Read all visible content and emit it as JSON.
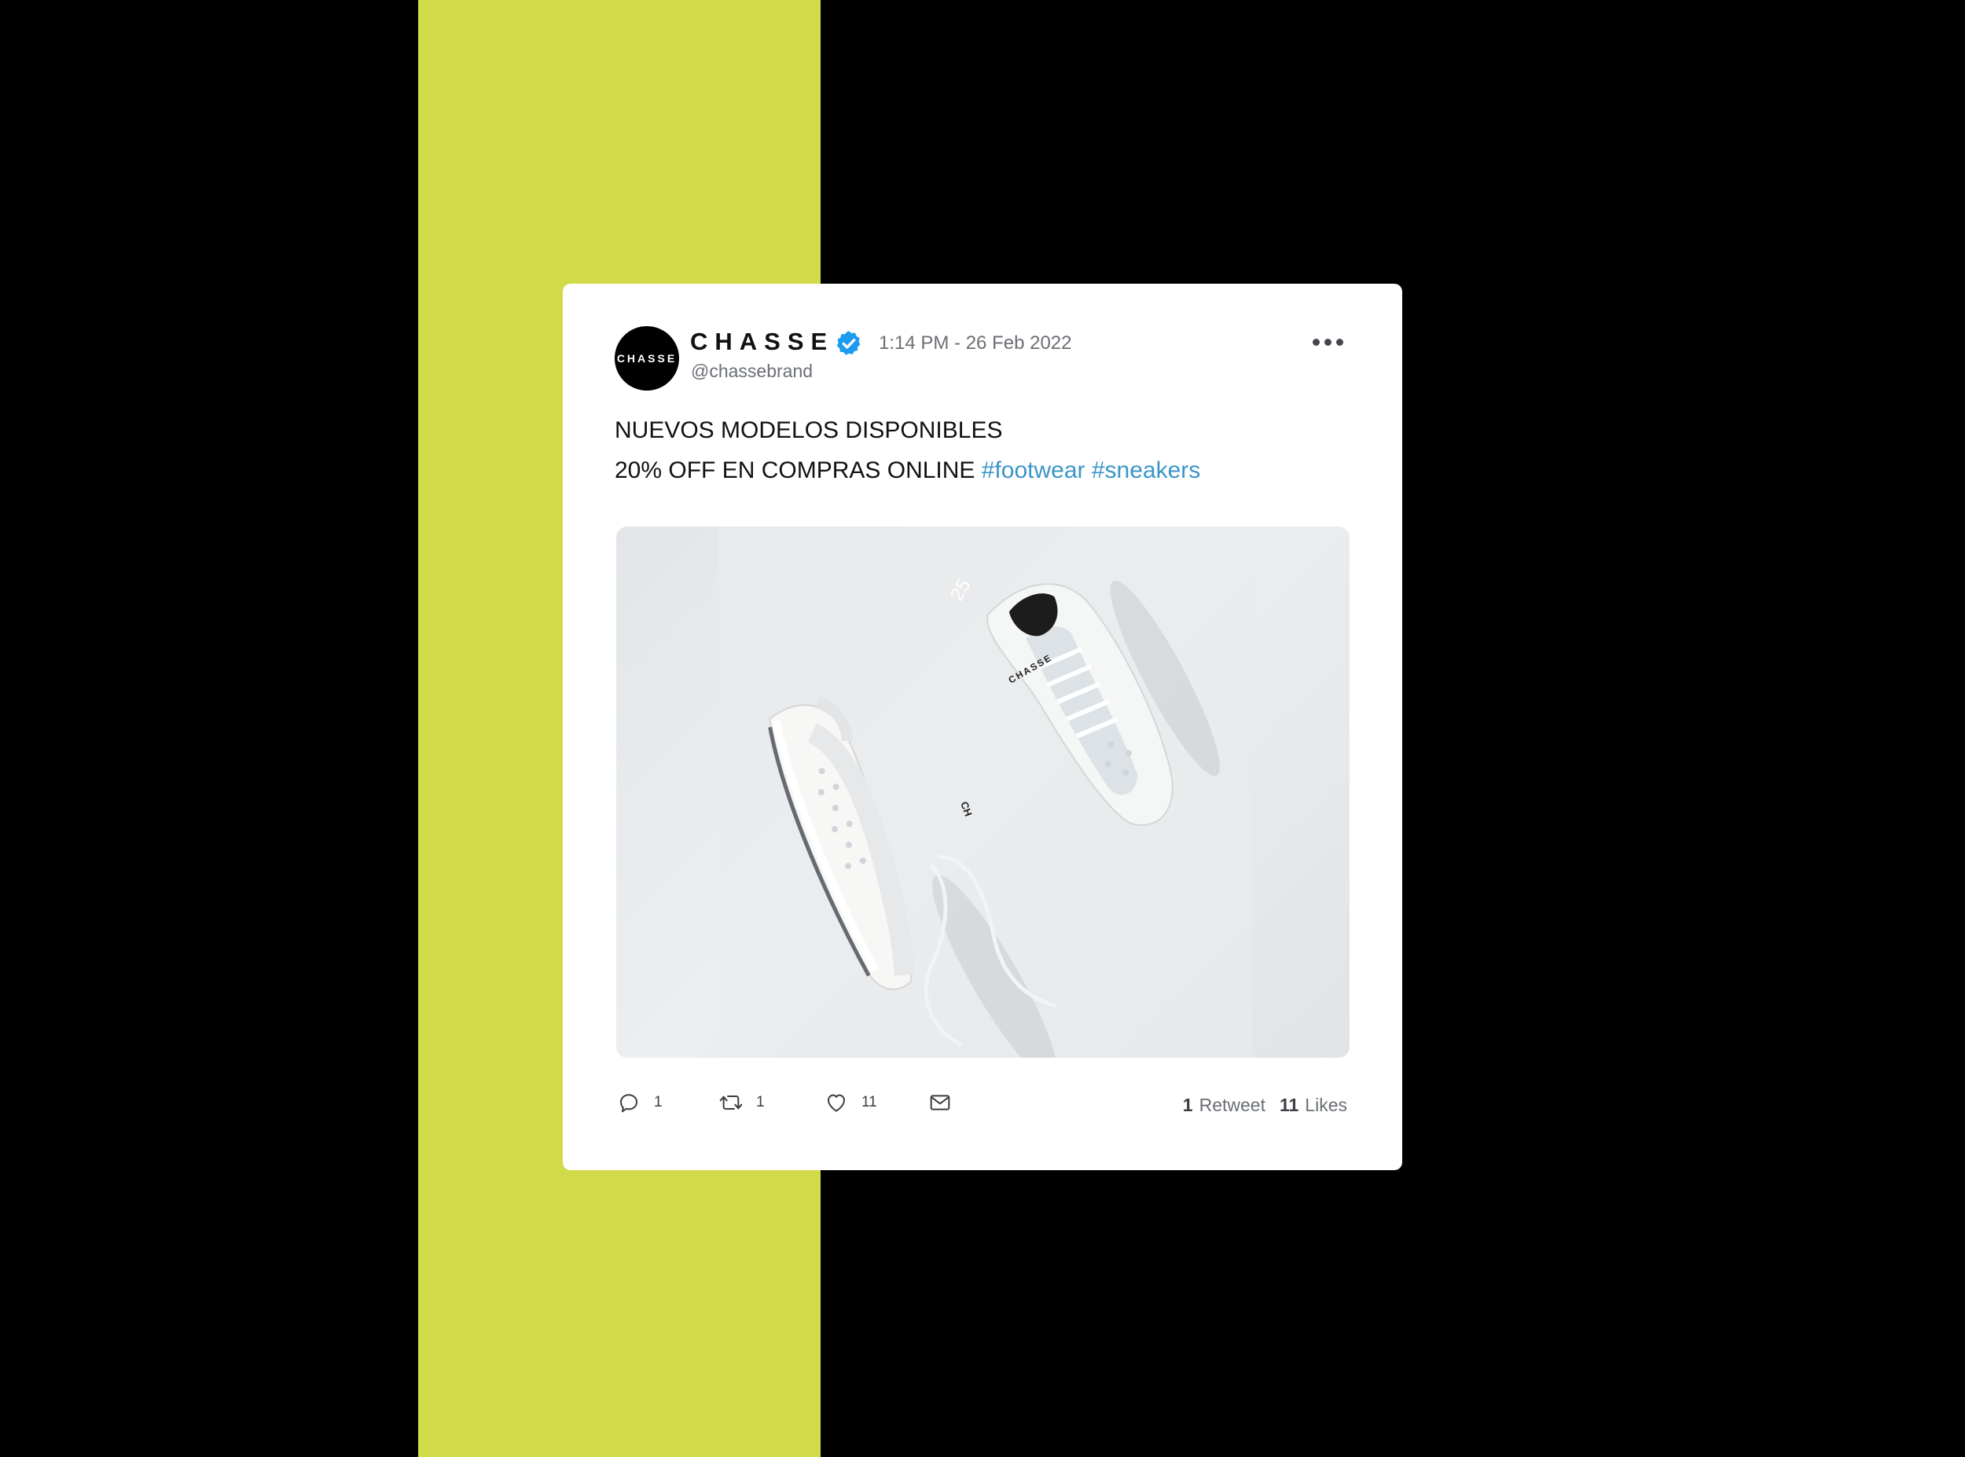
{
  "colors": {
    "background": "#000000",
    "accent_stripe": "#d1db4a",
    "card": "#ffffff",
    "hashtag": "#3a96c8",
    "verified_badge": "#1d9bf0",
    "muted_text": "#6b6f74"
  },
  "tweet": {
    "avatar_text": "CHASSE",
    "display_name": "CHASSE",
    "verified_icon": "verified-badge-icon",
    "timestamp": "1:14 PM - 26 Feb 2022",
    "handle": "@chassebrand",
    "more_icon": "more-dots-icon",
    "text_line1": "NUEVOS MODELOS DISPONIBLES",
    "text_line2": "20% OFF EN COMPRAS ONLINE",
    "hashtags": [
      "#footwear",
      "#sneakers"
    ],
    "photo": {
      "shoe_tongue_number": "25",
      "shoe_brand": "CHASSE"
    },
    "actions": {
      "reply": {
        "icon": "reply-icon",
        "count": "1"
      },
      "retweet": {
        "icon": "retweet-icon",
        "count": "1"
      },
      "like": {
        "icon": "heart-icon",
        "count": "11"
      },
      "message": {
        "icon": "mail-icon"
      }
    },
    "stats": {
      "retweets_count": "1",
      "retweets_label": "Retweet",
      "likes_count": "11",
      "likes_label": "Likes"
    }
  }
}
